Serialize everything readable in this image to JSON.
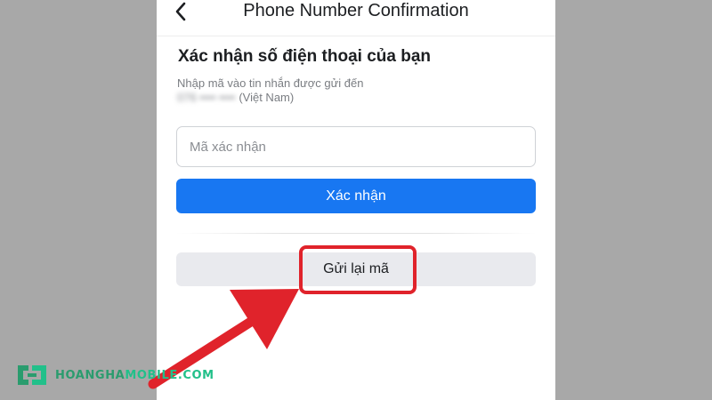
{
  "header": {
    "title": "Phone Number Confirmation",
    "back_icon": "chevron-left-icon"
  },
  "content": {
    "title": "Xác nhận số điện thoại của bạn",
    "instruction": "Nhập mã vào tin nhắn được gửi đến",
    "phone_number_masked": "076 •••• ••••",
    "country": "(Việt Nam)"
  },
  "form": {
    "code_placeholder": "Mã xác nhận",
    "code_value": "",
    "confirm_label": "Xác nhận",
    "resend_label": "Gửi lại mã"
  },
  "colors": {
    "primary": "#1877f2",
    "highlight": "#e0232b",
    "background_outer": "#a8a8a8"
  },
  "watermark": {
    "text_a": "HOANGHA",
    "text_b": "MOBILE.COM"
  }
}
